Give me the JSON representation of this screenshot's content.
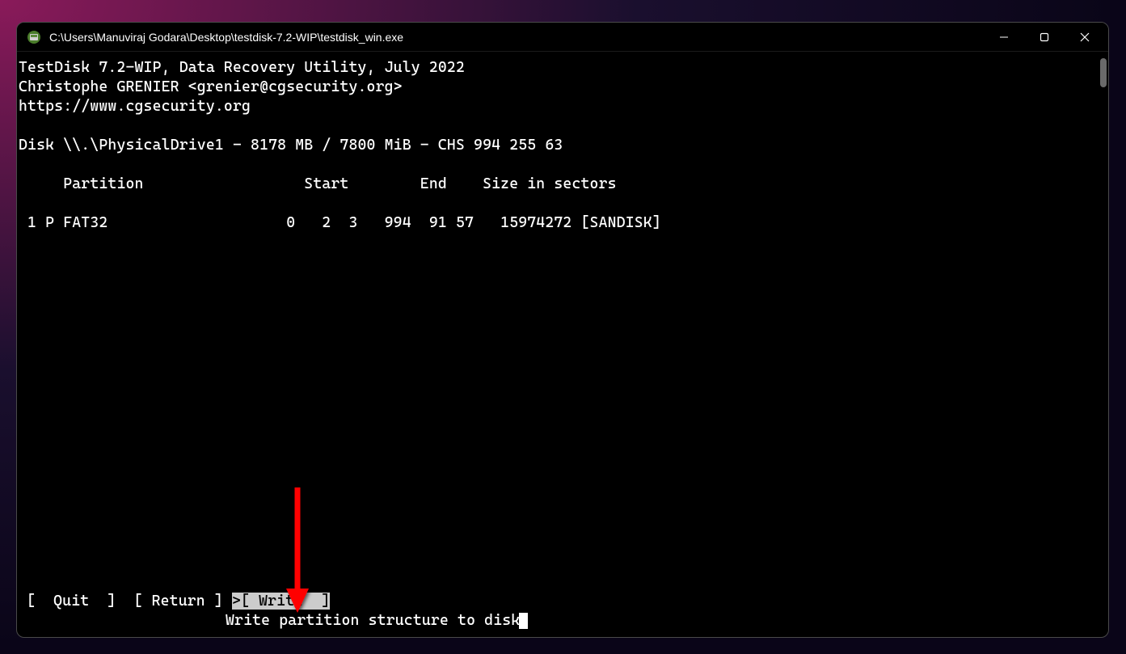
{
  "titlebar": {
    "title": "C:\\Users\\Manuviraj Godara\\Desktop\\testdisk-7.2-WIP\\testdisk_win.exe"
  },
  "header": {
    "line1": "TestDisk 7.2-WIP, Data Recovery Utility, July 2022",
    "line2": "Christophe GRENIER <grenier@cgsecurity.org>",
    "line3": "https://www.cgsecurity.org"
  },
  "disk": {
    "info": "Disk \\\\.\\PhysicalDrive1 - 8178 MB / 7800 MiB - CHS 994 255 63"
  },
  "table": {
    "header": "     Partition                  Start        End    Size in sectors",
    "row1": " 1 P FAT32                    0   2  3   994  91 57   15974272 [SANDISK]"
  },
  "menu": {
    "quit": "[  Quit  ]",
    "return": "[ Return ]",
    "write_prefix": ">",
    "write": "[ Write  ]"
  },
  "hint": "Write partition structure to disk"
}
